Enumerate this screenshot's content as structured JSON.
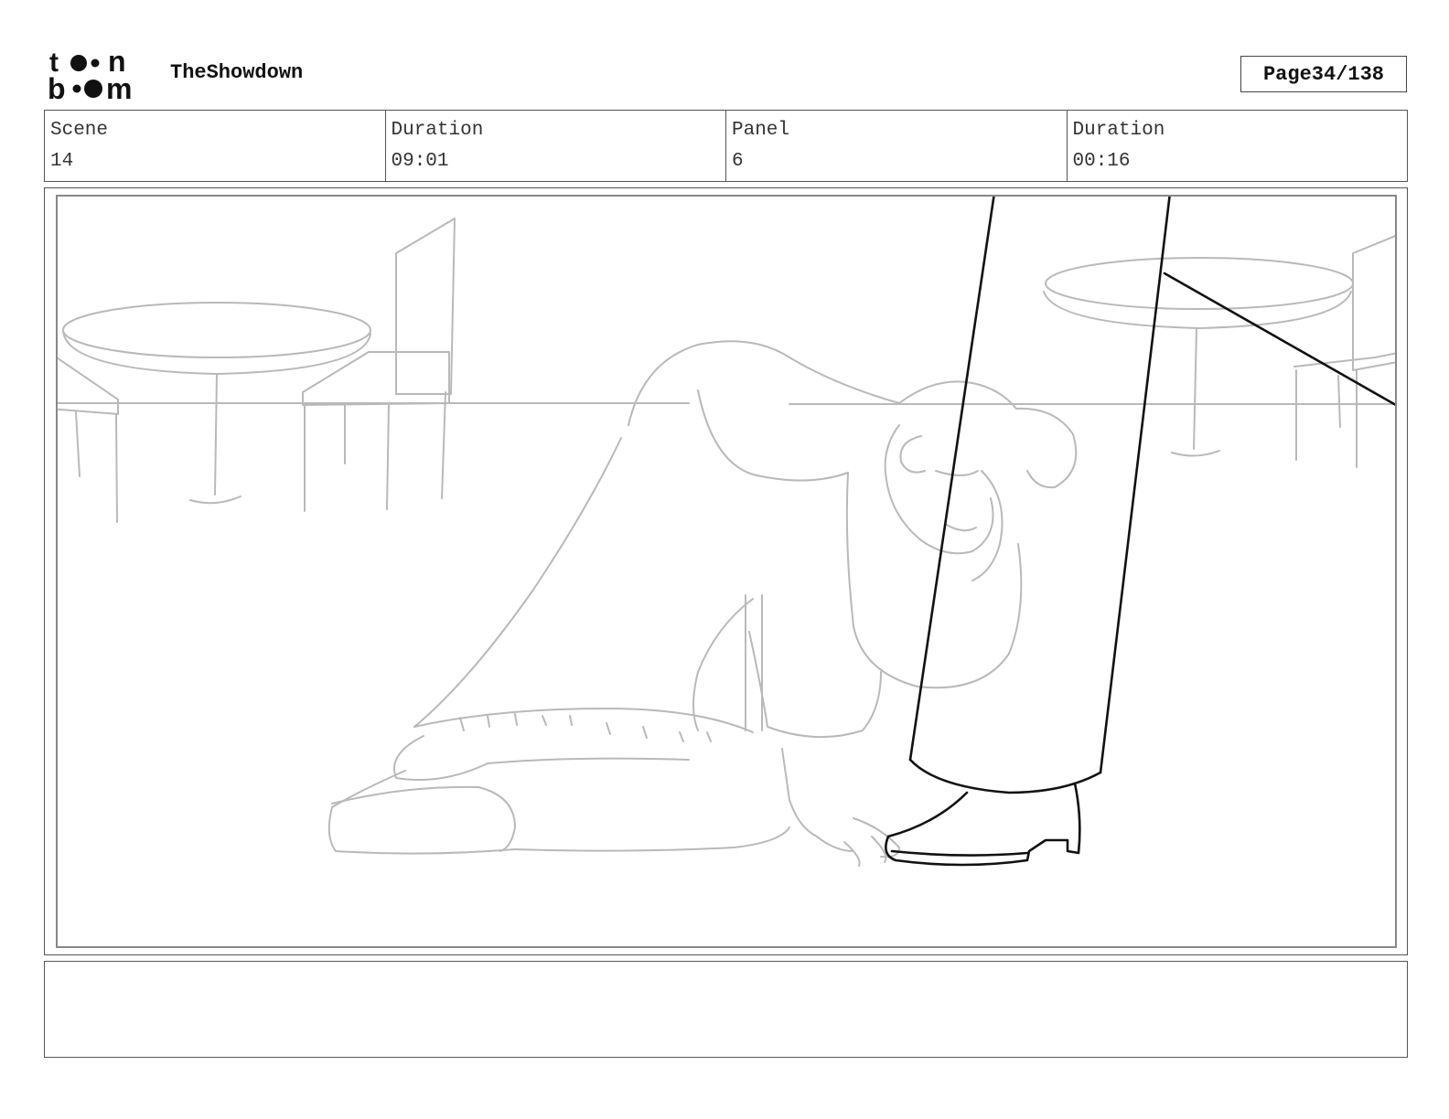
{
  "header": {
    "logo_text": "toonboom",
    "project_title": "TheShowdown",
    "page_label": "Page",
    "page_value": "34/138"
  },
  "info": {
    "scene_label": "Scene",
    "scene_value": "14",
    "scene_duration_label": "Duration",
    "scene_duration_value": "09:01",
    "panel_label": "Panel",
    "panel_value": "6",
    "panel_duration_label": "Duration",
    "panel_duration_value": "00:16"
  },
  "caption": {
    "text": ""
  },
  "colors": {
    "sketch_light": "#b9b9b9",
    "sketch_dark": "#111111",
    "frame_border": "#555555"
  }
}
